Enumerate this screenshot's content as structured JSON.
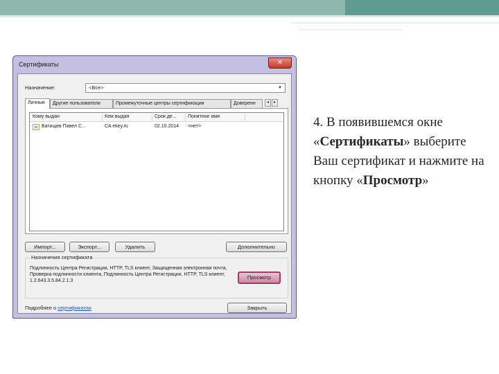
{
  "dialog": {
    "title": "Сертификаты",
    "close_glyph": "✕",
    "purpose_label": "Назначение:",
    "purpose_value": "<Все>",
    "tabs": [
      {
        "label": "Личные",
        "active": true
      },
      {
        "label": "Другие пользователи",
        "active": false
      },
      {
        "label": "Промежуточные центры сертификации",
        "active": false
      },
      {
        "label": "Доверенн",
        "active": false
      }
    ],
    "tab_scroll_left": "◂",
    "tab_scroll_right": "▸",
    "columns": [
      "Кому выдан",
      "Кем выдан",
      "Срок де...",
      "Понятное имя"
    ],
    "rows": [
      {
        "issued_to": "Батищев Павел С...",
        "issued_by": "CA ekey.ru",
        "expires": "02.10.2014",
        "friendly_name": "<нет>"
      }
    ],
    "buttons": {
      "import": "Импорт...",
      "export": "Экспорт...",
      "remove": "Удалить",
      "advanced": "Дополнительно",
      "view": "Просмотр",
      "close": "Закрыть"
    },
    "group_title": "Назначения сертификата",
    "purposes_text": "Подлинность Центра Регистрации, HTTP, TLS клиент, Защищенная электронная почта, Проверка подлинности клиента, Подлинность Центра Регистрации, HTTP, TLS клиент, 1.2.643.3.5.84.2.1.3",
    "more_info_prefix": "Подробнее о",
    "more_info_link": "сертификатах"
  },
  "slide": {
    "text_prefix": "4. В появившемся окне «",
    "text_bold1": "Сертификаты",
    "text_mid": "» выберите Ваш сертификат и нажмите на кнопку «",
    "text_bold2": "Просмотр",
    "text_suffix": "»"
  },
  "colors": {
    "accent_band": "#8fb8ad",
    "window_frame": "#c5c0e2",
    "close_button": "#c23a28",
    "view_button_border": "#a33b61"
  }
}
